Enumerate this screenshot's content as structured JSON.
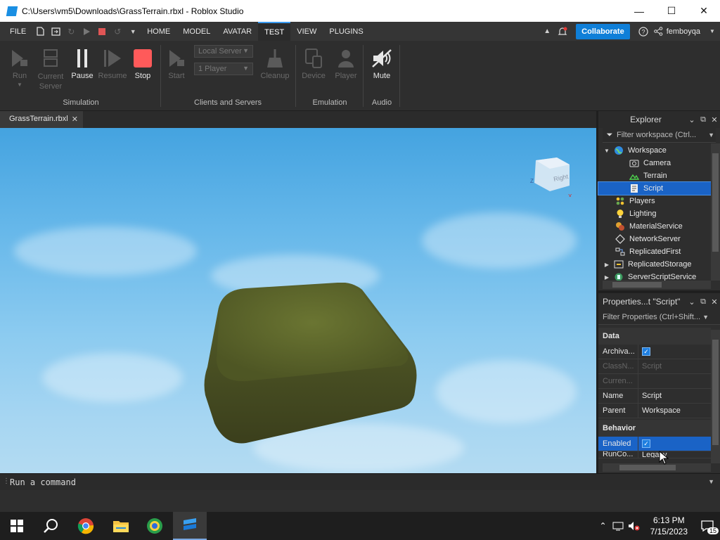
{
  "window": {
    "title": "C:\\Users\\vm5\\Downloads\\GrassTerrain.rbxl - Roblox Studio"
  },
  "menubar": {
    "file": "FILE",
    "tabs": [
      "HOME",
      "MODEL",
      "AVATAR",
      "TEST",
      "VIEW",
      "PLUGINS"
    ],
    "active_tab": "TEST",
    "collaborate": "Collaborate",
    "username": "femboyqa"
  },
  "ribbon": {
    "simulation": {
      "label": "Simulation",
      "run": "Run",
      "current_server": "Current Server",
      "pause": "Pause",
      "resume": "Resume",
      "stop": "Stop"
    },
    "clients": {
      "label": "Clients and Servers",
      "start": "Start",
      "server_dropdown": "Local Server",
      "players_dropdown": "1 Player",
      "cleanup": "Cleanup"
    },
    "emulation": {
      "label": "Emulation",
      "device": "Device",
      "player": "Player"
    },
    "audio": {
      "label": "Audio",
      "mute": "Mute"
    }
  },
  "doc_tab": {
    "name": "GrassTerrain.rbxl"
  },
  "viewport": {
    "viewcube_face": "Right",
    "axis_z": "Z",
    "axis_x": "X"
  },
  "explorer": {
    "title": "Explorer",
    "filter": "Filter workspace (Ctrl...",
    "items": [
      {
        "label": "Workspace",
        "depth": 0,
        "expanded": true,
        "icon": "globe-icon"
      },
      {
        "label": "Camera",
        "depth": 1,
        "icon": "camera-icon"
      },
      {
        "label": "Terrain",
        "depth": 1,
        "icon": "terrain-icon"
      },
      {
        "label": "Script",
        "depth": 1,
        "icon": "script-icon",
        "selected": true
      },
      {
        "label": "Players",
        "depth": 0,
        "icon": "players-icon"
      },
      {
        "label": "Lighting",
        "depth": 0,
        "icon": "lightbulb-icon"
      },
      {
        "label": "MaterialService",
        "depth": 0,
        "icon": "material-icon"
      },
      {
        "label": "NetworkServer",
        "depth": 0,
        "icon": "network-icon"
      },
      {
        "label": "ReplicatedFirst",
        "depth": 0,
        "icon": "replicated-first-icon"
      },
      {
        "label": "ReplicatedStorage",
        "depth": 0,
        "collapsed": true,
        "icon": "replicated-storage-icon"
      },
      {
        "label": "ServerScriptService",
        "depth": 0,
        "collapsed": true,
        "icon": "server-script-icon"
      }
    ]
  },
  "properties": {
    "title": "Properties...t \"Script\"",
    "filter": "Filter Properties (Ctrl+Shift...",
    "sections": {
      "data": "Data",
      "behavior": "Behavior"
    },
    "rows": {
      "archivable": {
        "name": "Archiva...",
        "checked": true
      },
      "classname": {
        "name": "ClassN...",
        "value": "Script"
      },
      "current": {
        "name": "Curren...",
        "value": ""
      },
      "name": {
        "name": "Name",
        "value": "Script"
      },
      "parent": {
        "name": "Parent",
        "value": "Workspace"
      },
      "enabled": {
        "name": "Enabled",
        "checked": true
      },
      "runcontext": {
        "name": "RunCo...",
        "value": "Legacy"
      }
    }
  },
  "command_bar": {
    "placeholder": "Run a command"
  },
  "taskbar": {
    "time": "6:13 PM",
    "date": "7/15/2023",
    "notifications": "15"
  },
  "colors": {
    "accent": "#1a63c6",
    "collaborate": "#0f7fd8",
    "stop": "#ff5a5a"
  }
}
